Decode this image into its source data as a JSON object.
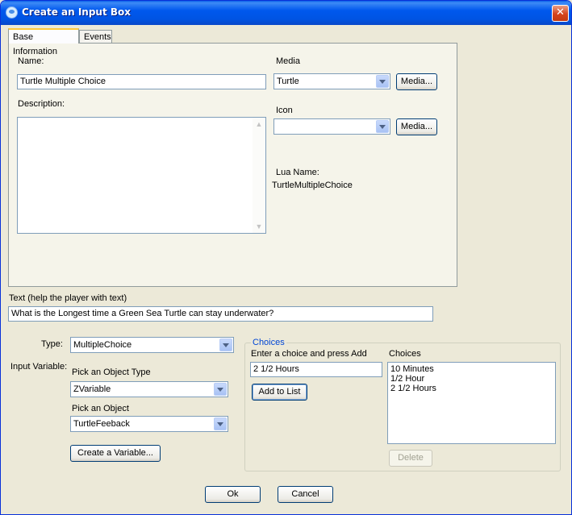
{
  "window": {
    "title": "Create an Input Box",
    "close_glyph": "✕"
  },
  "tabs": [
    {
      "label": "Base Information",
      "active": true
    },
    {
      "label": "Events",
      "active": false
    }
  ],
  "base_info": {
    "name_label": "Name:",
    "name_value": "Turtle Multiple Choice",
    "description_label": "Description:",
    "description_value": "",
    "media_label": "Media",
    "media_value": "Turtle",
    "media_button": "Media...",
    "icon_label": "Icon",
    "icon_value": "",
    "icon_button": "Media...",
    "lua_name_label": "Lua Name:",
    "lua_name_value": "TurtleMultipleChoice"
  },
  "text_section": {
    "label": "Text (help the player with text)",
    "value": "What is the Longest time a Green Sea Turtle can stay underwater?"
  },
  "type_section": {
    "type_label": "Type:",
    "type_value": "MultipleChoice",
    "input_variable_label": "Input Variable:",
    "object_type_label": "Pick an Object Type",
    "object_type_value": "ZVariable",
    "object_label": "Pick an Object",
    "object_value": "TurtleFeeback",
    "create_variable_button": "Create a Variable..."
  },
  "choices": {
    "group_title": "Choices",
    "enter_label": "Enter a choice and press Add",
    "enter_value": "2 1/2 Hours",
    "add_button": "Add to List",
    "list_label": "Choices",
    "items": [
      "10 Minutes",
      "1/2 Hour",
      "2 1/2 Hours"
    ],
    "delete_button": "Delete"
  },
  "footer": {
    "ok_button": "Ok",
    "cancel_button": "Cancel"
  },
  "colors": {
    "titlebar": "#0054e3",
    "dialog_bg": "#ece9d8",
    "group_title": "#0046d5",
    "input_border": "#7f9db9"
  }
}
